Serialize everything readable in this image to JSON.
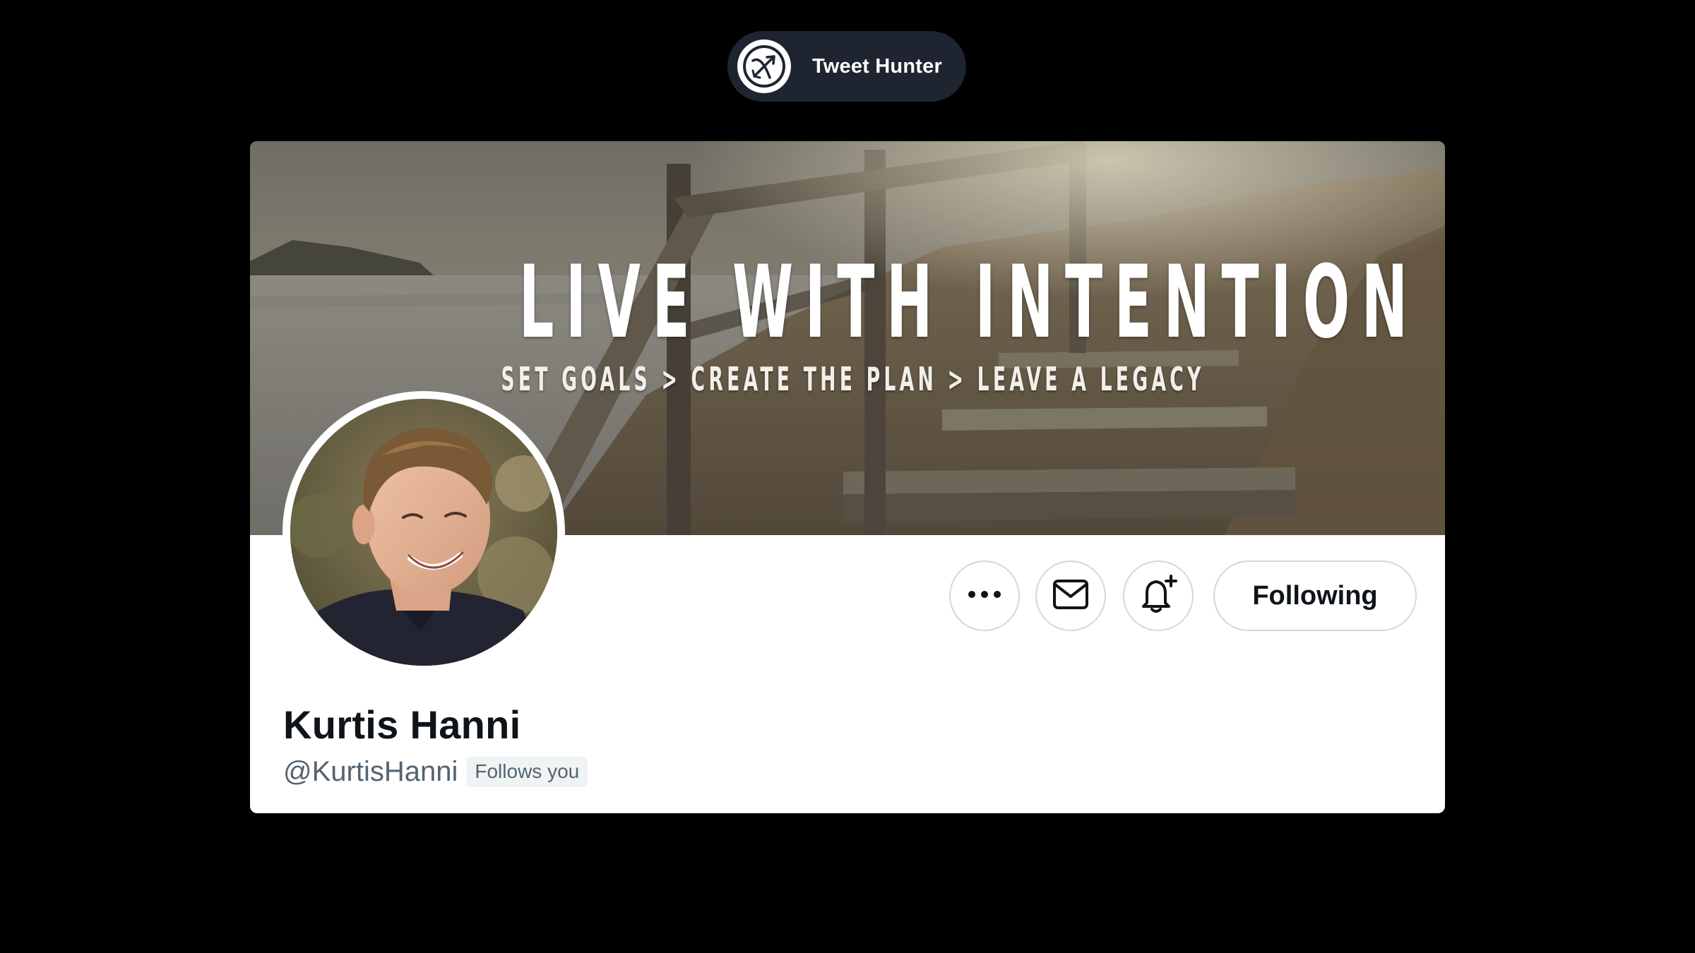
{
  "brand": {
    "name": "Tweet Hunter",
    "logo_icon": "bow-and-arrow-icon"
  },
  "profile": {
    "banner": {
      "title": "LIVE WITH INTENTION",
      "subtitle": "SET GOALS > CREATE THE PLAN > LEAVE A LEGACY"
    },
    "display_name": "Kurtis Hanni",
    "handle": "@KurtisHanni",
    "follows_you_badge": "Follows you",
    "actions": {
      "more_icon": "more-horizontal-icon",
      "message_icon": "envelope-icon",
      "notify_icon": "bell-plus-icon",
      "follow_label": "Following"
    }
  },
  "colors": {
    "page_background": "#000000",
    "pill_background": "#1e2430",
    "card_background": "#ffffff",
    "primary_text": "#0f1419",
    "secondary_text": "#536471",
    "button_border": "#cfd9de",
    "badge_background": "#eff3f4"
  }
}
